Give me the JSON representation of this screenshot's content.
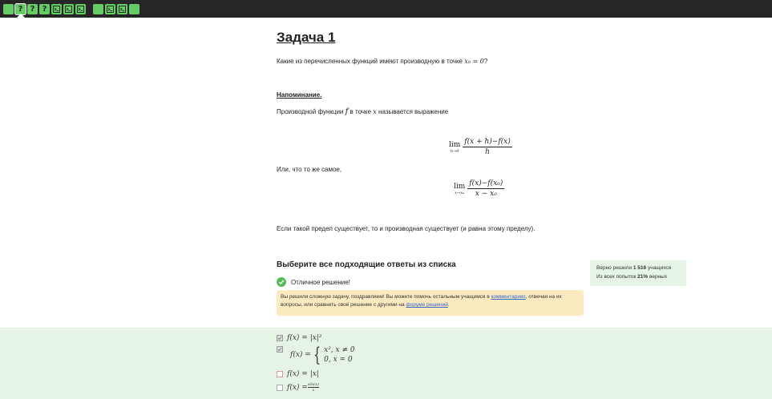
{
  "toolbar": {
    "steps": [
      {
        "kind": "text",
        "label": "",
        "icon": "empty-step-icon"
      },
      {
        "kind": "question",
        "label": "?",
        "icon": "question-icon",
        "active": true
      },
      {
        "kind": "question",
        "label": "?",
        "icon": "question-icon"
      },
      {
        "kind": "question",
        "label": "?",
        "icon": "question-icon"
      },
      {
        "kind": "code",
        "label": "",
        "icon": "code-terminal-icon"
      },
      {
        "kind": "code",
        "label": "",
        "icon": "code-terminal-icon"
      },
      {
        "kind": "code",
        "label": "",
        "icon": "code-terminal-icon"
      },
      {
        "kind": "text",
        "label": "",
        "icon": "empty-step-icon"
      },
      {
        "kind": "code",
        "label": "",
        "icon": "code-terminal-icon"
      },
      {
        "kind": "code",
        "label": "",
        "icon": "code-terminal-icon"
      },
      {
        "kind": "text",
        "label": "",
        "icon": "empty-step-icon"
      }
    ],
    "step_color": "#66cc66",
    "bar_color": "#262626"
  },
  "task": {
    "title": "Задача 1",
    "question_prefix": "Какие из перечисленных функций имеют производную в точке ",
    "question_math": "x₀ = 0",
    "question_suffix": "?",
    "reminder_label": "Напоминание.",
    "definition_prefix": "Производной функции ",
    "definition_f": "f",
    "definition_mid": " в точке ",
    "definition_x": "x",
    "definition_suffix": " называется выражение",
    "formula1": {
      "lim": "lim",
      "sub": "h→0",
      "num": "f(x + h)−f(x)",
      "den": "h"
    },
    "or_text": "Или, что то же самое,",
    "formula2": {
      "lim": "lim",
      "sub": "x→x₀",
      "num": "f(x)−f(x₀)",
      "den": "x − x₀"
    },
    "conclusion": "Если такой предел существует, то и производная существует (и равна этому пределу)."
  },
  "answer_section": {
    "title": "Выберите все подходящие ответы из списка",
    "success_text": "Отличное решение!",
    "notice_before_link1": "Вы решили сложную задачу, поздравляем! Вы можете помочь остальным учащимся в ",
    "link1": "комментариях",
    "notice_between": ", отвечая на их вопросы, или сравнить своё решение с другими на ",
    "link2": "форуме решений",
    "notice_end": ".",
    "success_color": "#5cb85c"
  },
  "stats": {
    "line1_prefix": "Верно решили ",
    "line1_count": "1 516",
    "line1_suffix": " учащихся",
    "line2_prefix": "Из всех попыток ",
    "line2_percent": "21%",
    "line2_suffix": " верных"
  },
  "options": [
    {
      "checked": true,
      "text": "f(x) = |x|²"
    },
    {
      "checked": true,
      "lhs": "f(x) = ",
      "case1": "x², x ≠ 0",
      "case2": "0, x = 0"
    },
    {
      "checked": false,
      "text": "f(x) = |x|"
    },
    {
      "checked": false,
      "lhs": "f(x) = ",
      "frac_num": "sin(x)",
      "frac_den": "x"
    }
  ]
}
